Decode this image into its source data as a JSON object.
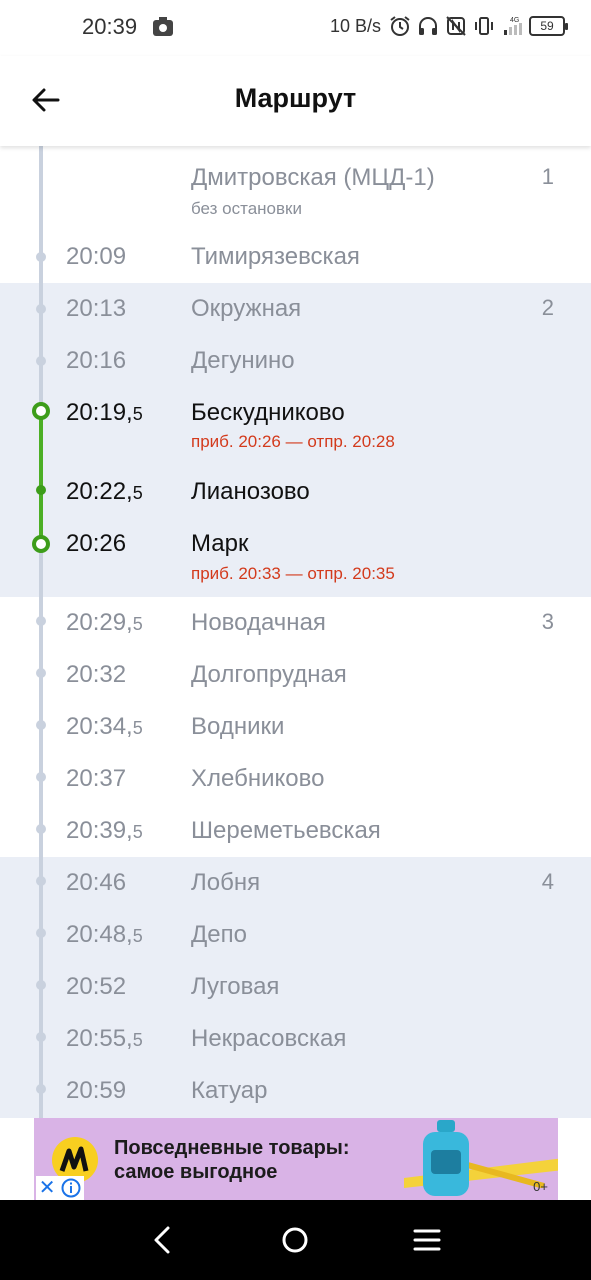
{
  "status_bar": {
    "time": "20:39",
    "speed": "10 B/s",
    "network": "4G",
    "battery": "59"
  },
  "header": {
    "title": "Маршрут",
    "back_icon": "arrow-left-icon"
  },
  "stops": [
    {
      "time": "",
      "half": "",
      "name": "Дмитровская (МЦД-1)",
      "note": "без остановки",
      "zone": "1"
    },
    {
      "time": "20:09",
      "half": "",
      "name": "Тимирязевская",
      "note": "",
      "zone": ""
    },
    {
      "time": "20:13",
      "half": "",
      "name": "Окружная",
      "note": "",
      "zone": "2"
    },
    {
      "time": "20:16",
      "half": "",
      "name": "Дегунино",
      "note": "",
      "zone": ""
    },
    {
      "time": "20:19,",
      "half": "5",
      "name": "Бескудниково",
      "note": "приб. 20:26 — отпр. 20:28",
      "zone": ""
    },
    {
      "time": "20:22,",
      "half": "5",
      "name": "Лианозово",
      "note": "",
      "zone": ""
    },
    {
      "time": "20:26",
      "half": "",
      "name": "Марк",
      "note": "приб. 20:33 — отпр. 20:35",
      "zone": ""
    },
    {
      "time": "20:29,",
      "half": "5",
      "name": "Новодачная",
      "note": "",
      "zone": "3"
    },
    {
      "time": "20:32",
      "half": "",
      "name": "Долгопрудная",
      "note": "",
      "zone": ""
    },
    {
      "time": "20:34,",
      "half": "5",
      "name": "Водники",
      "note": "",
      "zone": ""
    },
    {
      "time": "20:37",
      "half": "",
      "name": "Хлебниково",
      "note": "",
      "zone": ""
    },
    {
      "time": "20:39,",
      "half": "5",
      "name": "Шереметьевская",
      "note": "",
      "zone": ""
    },
    {
      "time": "20:46",
      "half": "",
      "name": "Лобня",
      "note": "",
      "zone": "4"
    },
    {
      "time": "20:48,",
      "half": "5",
      "name": "Депо",
      "note": "",
      "zone": ""
    },
    {
      "time": "20:52",
      "half": "",
      "name": "Луговая",
      "note": "",
      "zone": ""
    },
    {
      "time": "20:55,",
      "half": "5",
      "name": "Некрасовская",
      "note": "",
      "zone": ""
    },
    {
      "time": "20:59",
      "half": "",
      "name": "Катуар",
      "note": "",
      "zone": ""
    }
  ],
  "ad": {
    "line1": "Повседневные товары:",
    "line2": "самое выгодное",
    "age": "0+",
    "close_icon": "close-icon",
    "info_icon": "info-icon"
  },
  "colors": {
    "band": "#eaeef6",
    "rail": "#c9d1de",
    "active_line": "#4caf25",
    "note_red": "#d33a1c"
  }
}
